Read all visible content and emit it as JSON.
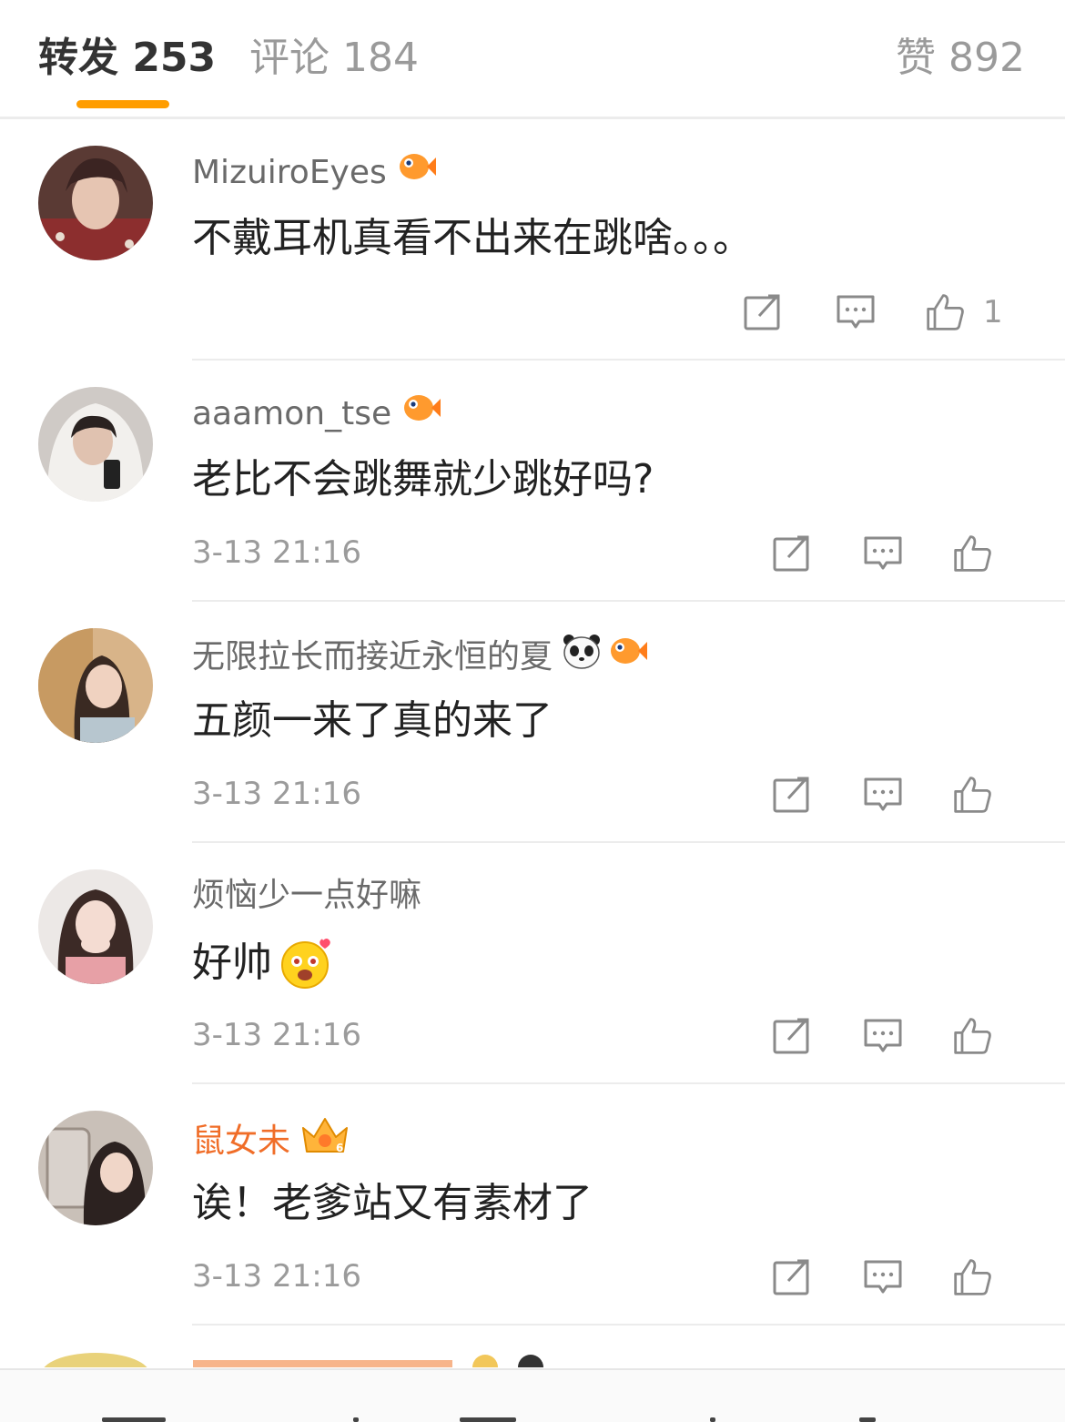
{
  "tabs": {
    "repost": "转发 253",
    "comment": "评论 184",
    "like": "赞 892"
  },
  "comments": [
    {
      "username": "MizuiroEyes",
      "text": "不戴耳机真看不出来在跳啥。。。",
      "time": "",
      "likes": "1"
    },
    {
      "username": "aaamon_tse",
      "text": "老比不会跳舞就少跳好吗?",
      "time": "3-13 21:16",
      "likes": ""
    },
    {
      "username": "无限拉长而接近永恒的夏",
      "text": "五颜一来了真的来了",
      "time": "3-13 21:16",
      "likes": ""
    },
    {
      "username": "烦恼少一点好嘛",
      "text": "好帅",
      "time": "3-13 21:16",
      "likes": ""
    },
    {
      "username": "鼠女未",
      "text": "诶！老爹站又有素材了",
      "time": "3-13 21:16",
      "likes": ""
    }
  ],
  "colors": {
    "accent": "#ff9d00",
    "vip_name": "#f06d28",
    "meta": "#9b9b9b"
  }
}
